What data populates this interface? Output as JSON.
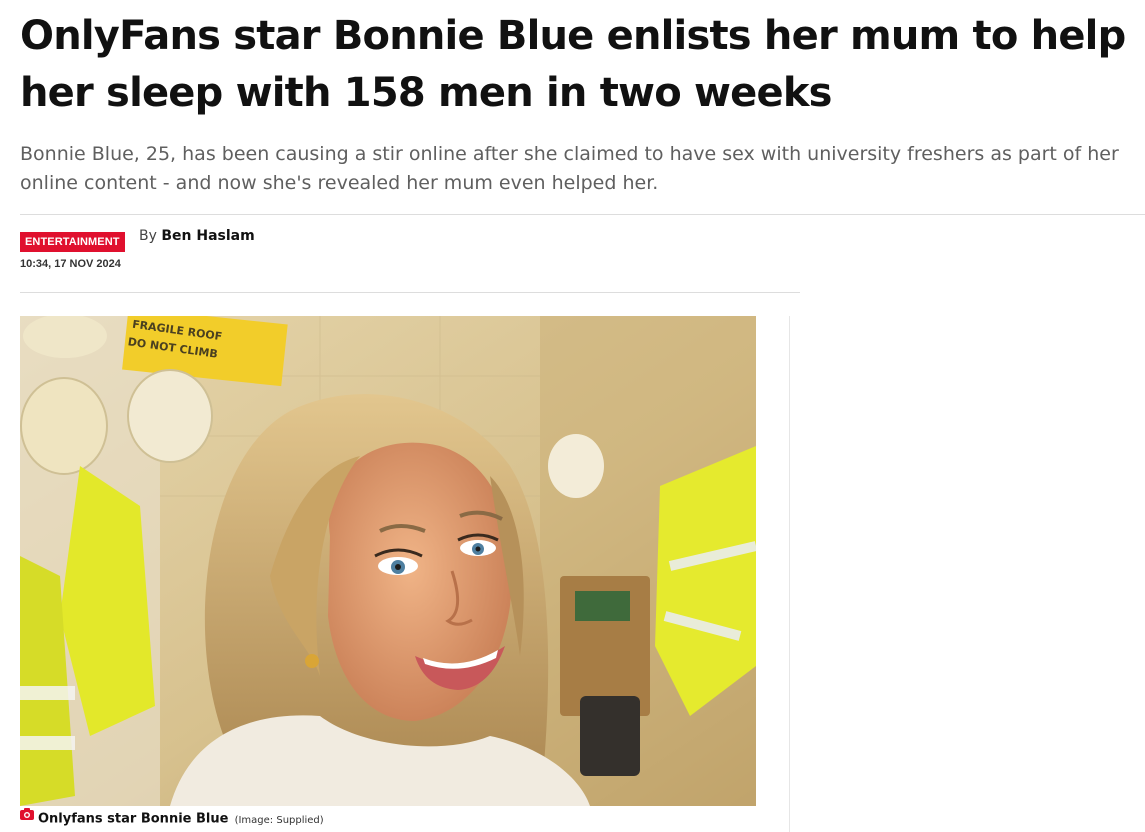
{
  "article": {
    "headline": "OnlyFans star Bonnie Blue enlists her mum to help her sleep with 158 men in two weeks",
    "standfirst": "Bonnie Blue, 25, has been causing a stir online after she claimed to have sex with university freshers as part of her online content - and now she's revealed her mum even helped her.",
    "section": "ENTERTAINMENT",
    "timestamp": "10:34, 17 NOV 2024",
    "byline_prefix": "By",
    "author": "Ben Haslam"
  },
  "image": {
    "caption": "Onlyfans star Bonnie Blue",
    "credit": "(Image: Supplied)",
    "sign_text": [
      "FRAGILE ROOF",
      "DO NOT CLIMB"
    ],
    "camera_icon": "camera-icon"
  },
  "colors": {
    "section_tag": "#e0102e",
    "headline": "#111111",
    "standfirst": "#5f5f5f",
    "rule": "#dddddd"
  }
}
